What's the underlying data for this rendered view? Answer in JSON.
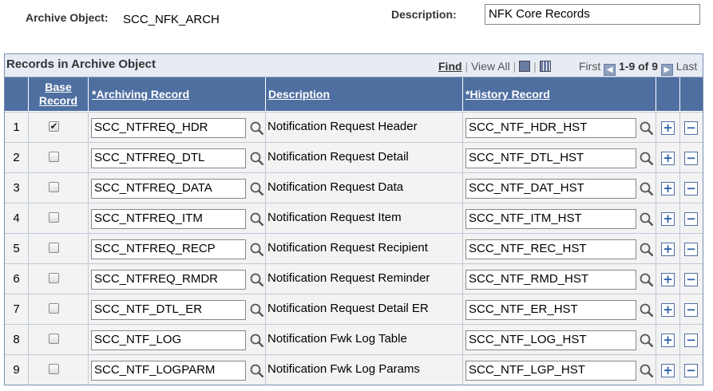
{
  "header": {
    "archive_label": "Archive Object:",
    "archive_value": "SCC_NFK_ARCH",
    "description_label": "Description:",
    "description_value": "NFK Core Records"
  },
  "grid": {
    "title": "Records in Archive Object",
    "nav": {
      "find": "Find",
      "view_all": "View All",
      "first": "First",
      "range": "1-9 of 9",
      "last": "Last",
      "zoom_icon": "zoom-icon",
      "download_icon": "download-icon"
    },
    "columns": {
      "base_record": "Base Record",
      "archiving_record": "*Archiving Record",
      "description": "Description",
      "history_record": "*History Record"
    },
    "rows": [
      {
        "num": "1",
        "base": true,
        "archiving": "SCC_NTFREQ_HDR",
        "description": "Notification Request Header",
        "history": "SCC_NTF_HDR_HST"
      },
      {
        "num": "2",
        "base": false,
        "archiving": "SCC_NTFREQ_DTL",
        "description": "Notification Request Detail",
        "history": "SCC_NTF_DTL_HST"
      },
      {
        "num": "3",
        "base": false,
        "archiving": "SCC_NTFREQ_DATA",
        "description": "Notification Request Data",
        "history": "SCC_NTF_DAT_HST"
      },
      {
        "num": "4",
        "base": false,
        "archiving": "SCC_NTFREQ_ITM",
        "description": "Notification Request Item",
        "history": "SCC_NTF_ITM_HST"
      },
      {
        "num": "5",
        "base": false,
        "archiving": "SCC_NTFREQ_RECP",
        "description": "Notification Request Recipient",
        "history": "SCC_NTF_REC_HST"
      },
      {
        "num": "6",
        "base": false,
        "archiving": "SCC_NTFREQ_RMDR",
        "description": "Notification Request Reminder",
        "history": "SCC_NTF_RMD_HST"
      },
      {
        "num": "7",
        "base": false,
        "archiving": "SCC_NTF_DTL_ER",
        "description": "Notification Request Detail ER",
        "history": "SCC_NTF_ER_HST"
      },
      {
        "num": "8",
        "base": false,
        "archiving": "SCC_NTF_LOG",
        "description": "Notification Fwk Log Table",
        "history": "SCC_NTF_LOG_HST"
      },
      {
        "num": "9",
        "base": false,
        "archiving": "SCC_NTF_LOGPARM",
        "description": "Notification Fwk Log Params",
        "history": "SCC_NTF_LGP_HST"
      }
    ],
    "row_buttons": {
      "add": "+",
      "delete": "−"
    }
  },
  "colors": {
    "header_bg": "#4f6fa1",
    "titlebar_bg": "#e7ecf4",
    "row_bg": "#f3f3f3"
  }
}
